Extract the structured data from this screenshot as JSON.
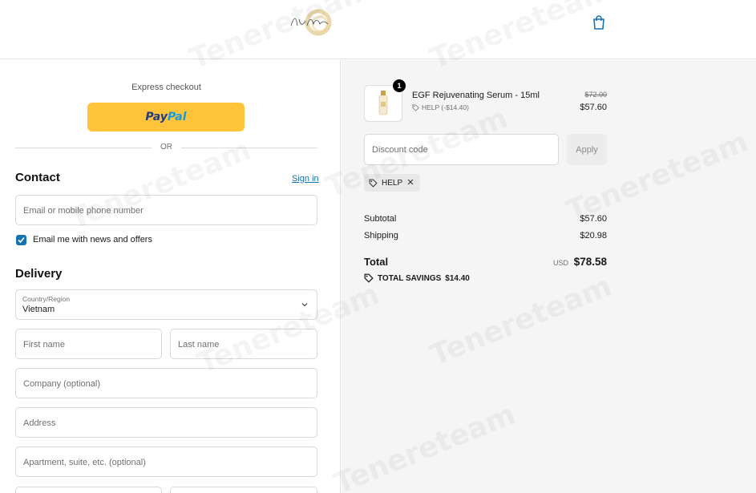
{
  "header": {
    "logo_name": "brand-logo",
    "cart_icon": "shopping-bag-icon"
  },
  "express": {
    "title": "Express checkout",
    "paypal_pay": "Pay",
    "paypal_pal": "Pal",
    "or_label": "OR"
  },
  "contact": {
    "heading": "Contact",
    "signin_label": "Sign in",
    "email_placeholder": "Email or mobile phone number",
    "newsletter_label": "Email me with news and offers",
    "newsletter_checked": true
  },
  "delivery": {
    "heading": "Delivery",
    "country_label": "Country/Region",
    "country_value": "Vietnam",
    "first_name_placeholder": "First name",
    "last_name_placeholder": "Last name",
    "company_placeholder": "Company (optional)",
    "address_placeholder": "Address",
    "apartment_placeholder": "Apartment, suite, etc. (optional)"
  },
  "summary": {
    "product": {
      "quantity": "1",
      "name": "EGF Rejuvenating Serum - 15ml",
      "discount": "HELP (-$14.40)",
      "old_price": "$72.00",
      "price": "$57.60"
    },
    "discount_placeholder": "Discount code",
    "apply_label": "Apply",
    "applied_code": "HELP",
    "subtotal_label": "Subtotal",
    "subtotal_value": "$57.60",
    "shipping_label": "Shipping",
    "shipping_value": "$20.98",
    "total_label": "Total",
    "currency": "USD",
    "total_value": "$78.58",
    "savings_label": "TOTAL SAVINGS",
    "savings_value": "$14.40"
  },
  "watermark": "Tenereteam",
  "colors": {
    "link": "#1773b0",
    "paypal": "#ffc439",
    "summary_bg": "#f5f5f5"
  }
}
